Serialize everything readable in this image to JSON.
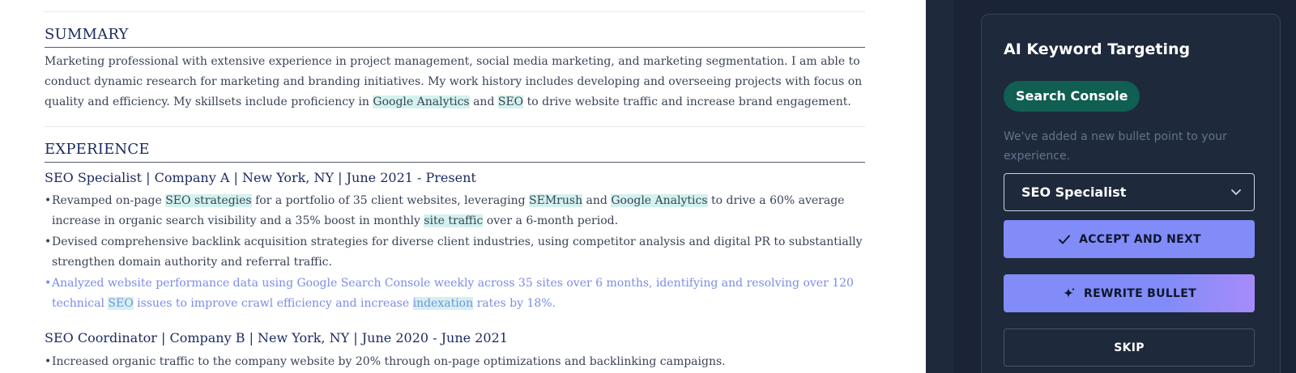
{
  "resume": {
    "summary": {
      "heading": "SUMMARY",
      "text_parts": [
        "Marketing professional with extensive experience in project management, social media marketing, and marketing segmentation. I am able to conduct dynamic research for marketing and branding initiatives. My work history includes developing and overseeing projects with focus on quality and efficiency. My skillsets include proficiency in ",
        "Google Analytics",
        " and ",
        "SEO",
        " to drive website traffic and increase brand engagement."
      ]
    },
    "experience": {
      "heading": "EXPERIENCE",
      "jobs": [
        {
          "title": "SEO Specialist | Company A | New York, NY | June 2021 - Present",
          "bullets": [
            {
              "parts": [
                "Revamped on-page ",
                "SEO strategies",
                " for a portfolio of 35 client websites, leveraging ",
                "SEMrush",
                " and ",
                "Google Analytics",
                " to drive a 60% average increase in organic search visibility and a 35% boost in monthly ",
                "site traffic",
                " over a 6-month period."
              ]
            },
            {
              "parts": [
                "Devised comprehensive backlink acquisition strategies for diverse client industries, using competitor analysis and digital PR to substantially strengthen domain authority and referral traffic."
              ]
            },
            {
              "parts": [
                "Analyzed website performance data using Google Search Console weekly across 35 sites over 6 months, identifying and resolving over 120 technical ",
                "SEO",
                " issues to improve crawl efficiency and increase ",
                "indexation",
                " rates by 18%."
              ]
            }
          ]
        },
        {
          "title": "SEO Coordinator | Company B | New York, NY | June 2020 - June 2021",
          "bullets": [
            {
              "parts": [
                "Increased organic traffic to the company website by 20% through on-page optimizations and backlinking campaigns."
              ]
            }
          ]
        }
      ]
    },
    "bullet_char": "•"
  },
  "panel": {
    "title": "AI Keyword Targeting",
    "chip_label": "Search Console",
    "note": "We've added a new bullet point to your experience.",
    "select_value": "SEO Specialist",
    "accept_label": "ACCEPT AND NEXT",
    "rewrite_label": "REWRITE BULLET",
    "skip_label": "SKIP"
  },
  "colors": {
    "highlight": "#d3f2ee",
    "new_bullet_text": "#7b8ce8",
    "chip_bg": "#115e52",
    "button_primary": "#818cf8",
    "panel_bg": "#1e293b"
  },
  "icons": [
    "check-icon",
    "sparkle-icon",
    "chevron-down-icon"
  ]
}
